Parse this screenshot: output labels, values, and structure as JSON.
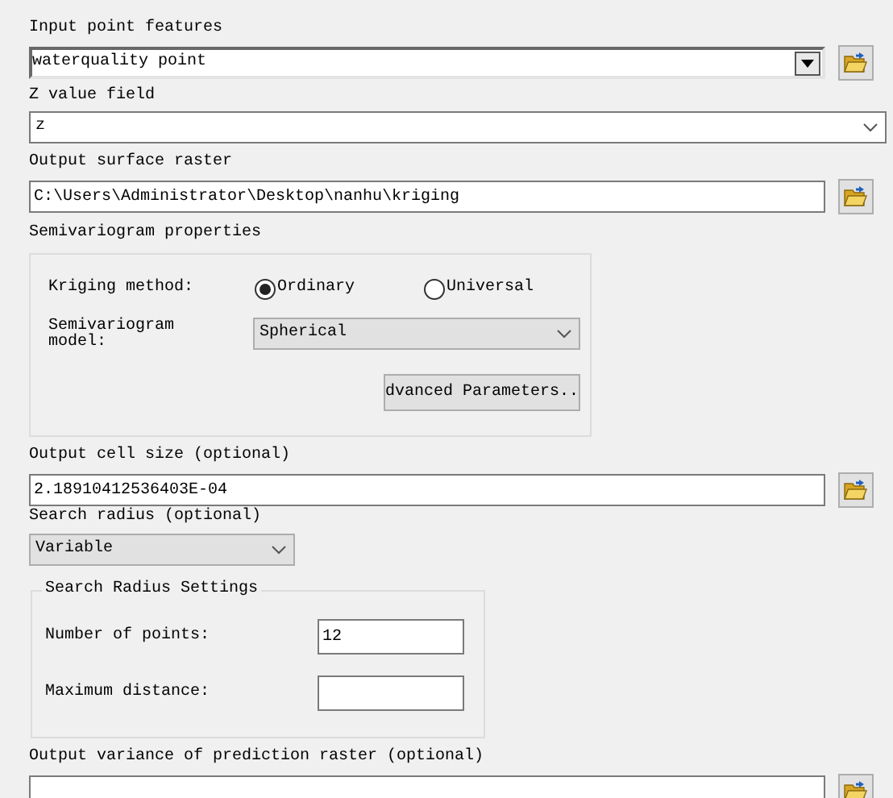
{
  "input_point_features": {
    "label": "Input point features",
    "value": "waterquality point"
  },
  "z_value_field": {
    "label": "Z value field",
    "value": "z"
  },
  "output_surface_raster": {
    "label": "Output surface raster",
    "value": "C:\\Users\\Administrator\\Desktop\\nanhu\\kriging"
  },
  "semivariogram_properties": {
    "title": "Semivariogram properties",
    "kriging_method": {
      "label": "Kriging method:",
      "options": [
        {
          "label": "Ordinary",
          "selected": true
        },
        {
          "label": "Universal",
          "selected": false
        }
      ]
    },
    "model": {
      "label": "Semivariogram model:",
      "value": "Spherical"
    },
    "advanced_button": "dvanced Parameters.."
  },
  "output_cell_size": {
    "label": "Output cell size (optional)",
    "value": "2.18910412536403E-04"
  },
  "search_radius": {
    "label": "Search radius (optional)",
    "value": "Variable",
    "settings": {
      "title": "Search Radius Settings",
      "fields": [
        {
          "label": "Number of points:",
          "value": "12"
        },
        {
          "label": "Maximum distance:"
        }
      ]
    }
  },
  "output_variance": {
    "label": "Output variance of prediction raster (optional)"
  }
}
